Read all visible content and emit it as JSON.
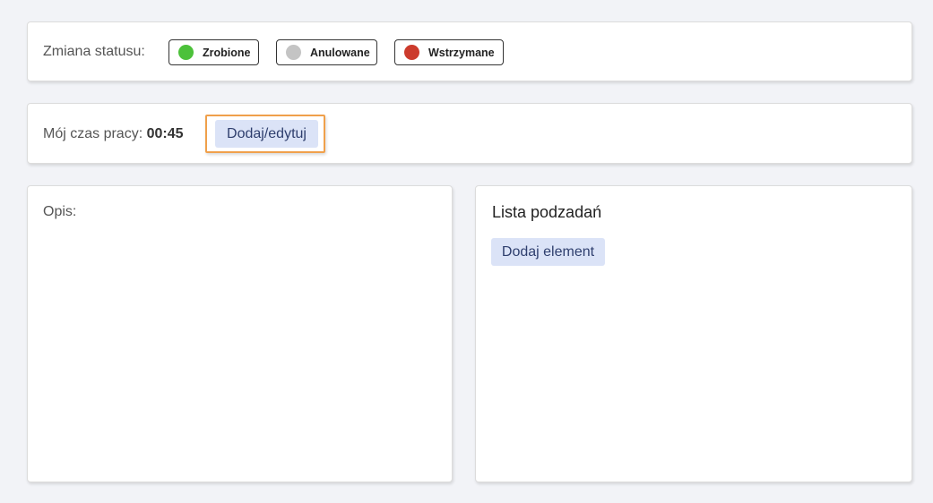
{
  "status": {
    "label": "Zmiana statusu:",
    "buttons": [
      {
        "label": "Zrobione",
        "color": "#4cc13a"
      },
      {
        "label": "Anulowane",
        "color": "#c4c4c4"
      },
      {
        "label": "Wstrzymane",
        "color": "#cc3b2c"
      }
    ]
  },
  "time": {
    "label": "Mój czas pracy:",
    "value": "00:45",
    "edit_button": "Dodaj/edytuj"
  },
  "description": {
    "label": "Opis:"
  },
  "subtasks": {
    "title": "Lista podzadań",
    "add_button": "Dodaj element"
  },
  "colors": {
    "background": "#f2f3f7",
    "button_soft": "#dbe3f7",
    "highlight": "#f0a04b"
  }
}
